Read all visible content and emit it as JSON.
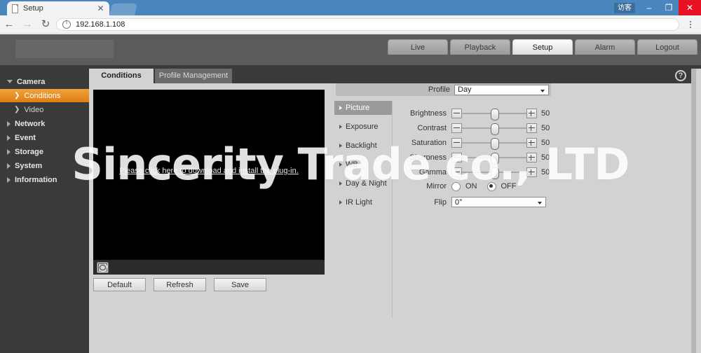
{
  "browser": {
    "tab": {
      "title": "Setup",
      "close_label": "✕",
      "favicon": "document-icon"
    },
    "window": {
      "guest_label": "访客",
      "minimize_label": "–",
      "maximize_label": "❐",
      "close_label": "✕"
    },
    "nav": {
      "back": "←",
      "forward": "→",
      "reload": "↻"
    },
    "url": "192.168.1.108",
    "menu_label": "chrome-menu"
  },
  "header": {
    "tabs": [
      {
        "label": "Live",
        "active": false
      },
      {
        "label": "Playback",
        "active": false
      },
      {
        "label": "Setup",
        "active": true
      },
      {
        "label": "Alarm",
        "active": false
      },
      {
        "label": "Logout",
        "active": false
      }
    ]
  },
  "sidebar": {
    "items": [
      {
        "label": "Camera",
        "type": "group-open",
        "active": false
      },
      {
        "label": "Conditions",
        "type": "sub",
        "active": true
      },
      {
        "label": "Video",
        "type": "sub",
        "active": false
      },
      {
        "label": "Network",
        "type": "group",
        "active": false
      },
      {
        "label": "Event",
        "type": "group",
        "active": false
      },
      {
        "label": "Storage",
        "type": "group",
        "active": false
      },
      {
        "label": "System",
        "type": "group",
        "active": false
      },
      {
        "label": "Information",
        "type": "group",
        "active": false
      }
    ]
  },
  "content": {
    "tabs": [
      {
        "label": "Conditions",
        "active": true
      },
      {
        "label": "Profile Management",
        "active": false
      }
    ],
    "help_label": "?",
    "video": {
      "plugin_message": "Please click here to download and install the plug-in.",
      "fullscreen_icon": "fullscreen-icon"
    },
    "buttons": [
      {
        "label": "Default"
      },
      {
        "label": "Refresh"
      },
      {
        "label": "Save"
      }
    ],
    "submenu": [
      {
        "label": "Picture",
        "active": true
      },
      {
        "label": "Exposure",
        "active": false
      },
      {
        "label": "Backlight",
        "active": false
      },
      {
        "label": "WB",
        "active": false
      },
      {
        "label": "Day & Night",
        "active": false
      },
      {
        "label": "IR Light",
        "active": false
      }
    ],
    "profile": {
      "label": "Profile",
      "value": "Day"
    },
    "sliders": [
      {
        "label": "Brightness",
        "value": "50",
        "percent": 50
      },
      {
        "label": "Contrast",
        "value": "50",
        "percent": 50
      },
      {
        "label": "Saturation",
        "value": "50",
        "percent": 50
      },
      {
        "label": "Sharpness",
        "value": "50",
        "percent": 50
      },
      {
        "label": "Gamma",
        "value": "50",
        "percent": 50
      }
    ],
    "stepper": {
      "minus": "minus-icon",
      "plus": "plus-icon"
    },
    "mirror": {
      "label": "Mirror",
      "on_label": "ON",
      "off_label": "OFF",
      "selected": "OFF"
    },
    "flip": {
      "label": "Flip",
      "value": "0°"
    }
  },
  "watermark": {
    "text": "Sincerity Trade co., LTD"
  },
  "colors": {
    "accent": "#e07c15",
    "chrome_tabstrip": "#4a86bd",
    "device_header": "#5b5b5b",
    "sidebar": "#3a3a3a",
    "panel": "#d2d2d2",
    "close_button": "#e81123"
  }
}
